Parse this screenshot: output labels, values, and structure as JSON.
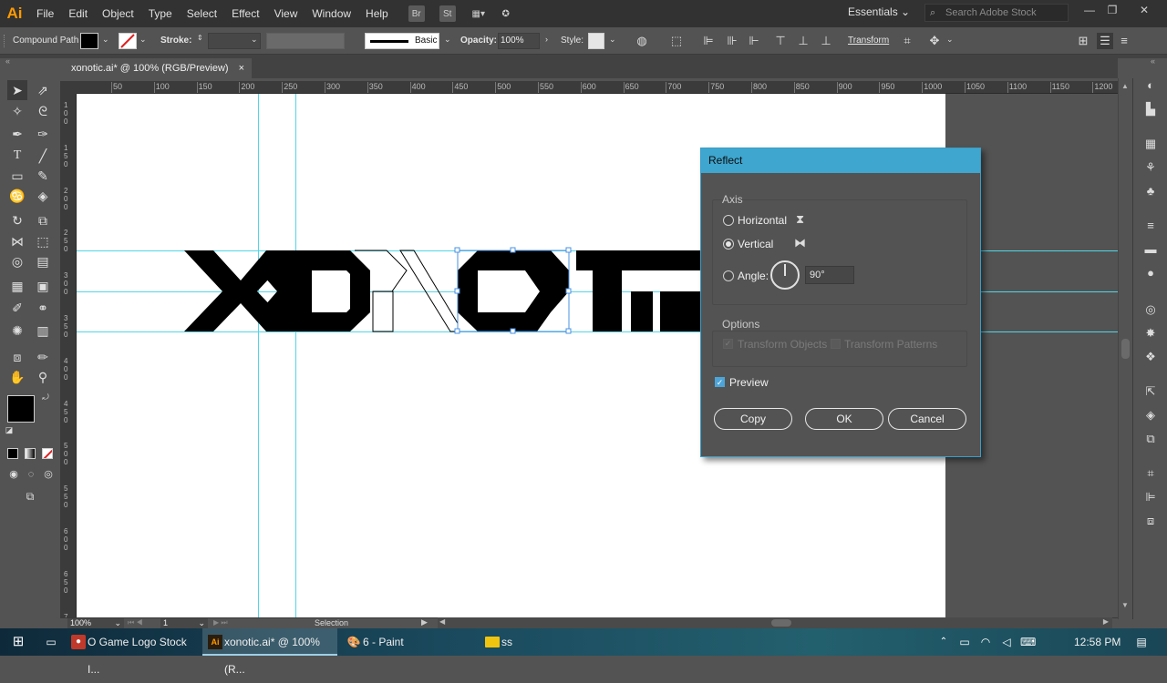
{
  "app": {
    "logo": "Ai"
  },
  "menu": [
    "File",
    "Edit",
    "Object",
    "Type",
    "Select",
    "Effect",
    "View",
    "Window",
    "Help"
  ],
  "menu_icons": {
    "bridge": "Br",
    "stock": "St"
  },
  "workspace": "Essentials",
  "search": {
    "placeholder": "Search Adobe Stock"
  },
  "control": {
    "selection_type": "Compound Path",
    "stroke_label": "Stroke:",
    "brush_label": "Basic",
    "opacity_label": "Opacity:",
    "opacity_value": "100%",
    "style_label": "Style:",
    "transform_label": "Transform"
  },
  "document": {
    "tab_title": "xonotic.ai* @ 100% (RGB/Preview)",
    "close": "×"
  },
  "ruler": {
    "h_ticks": [
      "50",
      "100",
      "150",
      "200",
      "250",
      "300",
      "350",
      "400",
      "450",
      "500",
      "550",
      "600",
      "650",
      "700",
      "750",
      "800",
      "850",
      "900",
      "950",
      "1000",
      "1050",
      "1100",
      "1150",
      "1200"
    ],
    "v_ticks": [
      "1\n0\n0",
      "1\n5\n0",
      "2\n0\n0",
      "2\n5\n0",
      "3\n0\n0",
      "3\n5\n0",
      "4\n0\n0",
      "4\n5\n0",
      "5\n0\n0",
      "5\n5\n0",
      "6\n0\n0",
      "6\n5\n0",
      "7\n0\n0"
    ]
  },
  "status": {
    "zoom": "100%",
    "artboard": "1",
    "tool": "Selection"
  },
  "dialog": {
    "title": "Reflect",
    "axis_label": "Axis",
    "horizontal": "Horizontal",
    "vertical": "Vertical",
    "angle_label": "Angle:",
    "angle_value": "90°",
    "options_label": "Options",
    "transform_objects": "Transform Objects",
    "transform_patterns": "Transform Patterns",
    "preview": "Preview",
    "copy": "Copy",
    "ok": "OK",
    "cancel": "Cancel"
  },
  "taskbar": {
    "items": [
      "O Game Logo Stock I...",
      "xonotic.ai* @ 100% (R...",
      "6 - Paint",
      "ss"
    ],
    "time": "12:58 PM"
  },
  "colors": {
    "accent": "#3ea6cf",
    "guide": "#4fd6e8",
    "ai_orange": "#ff9a00"
  }
}
